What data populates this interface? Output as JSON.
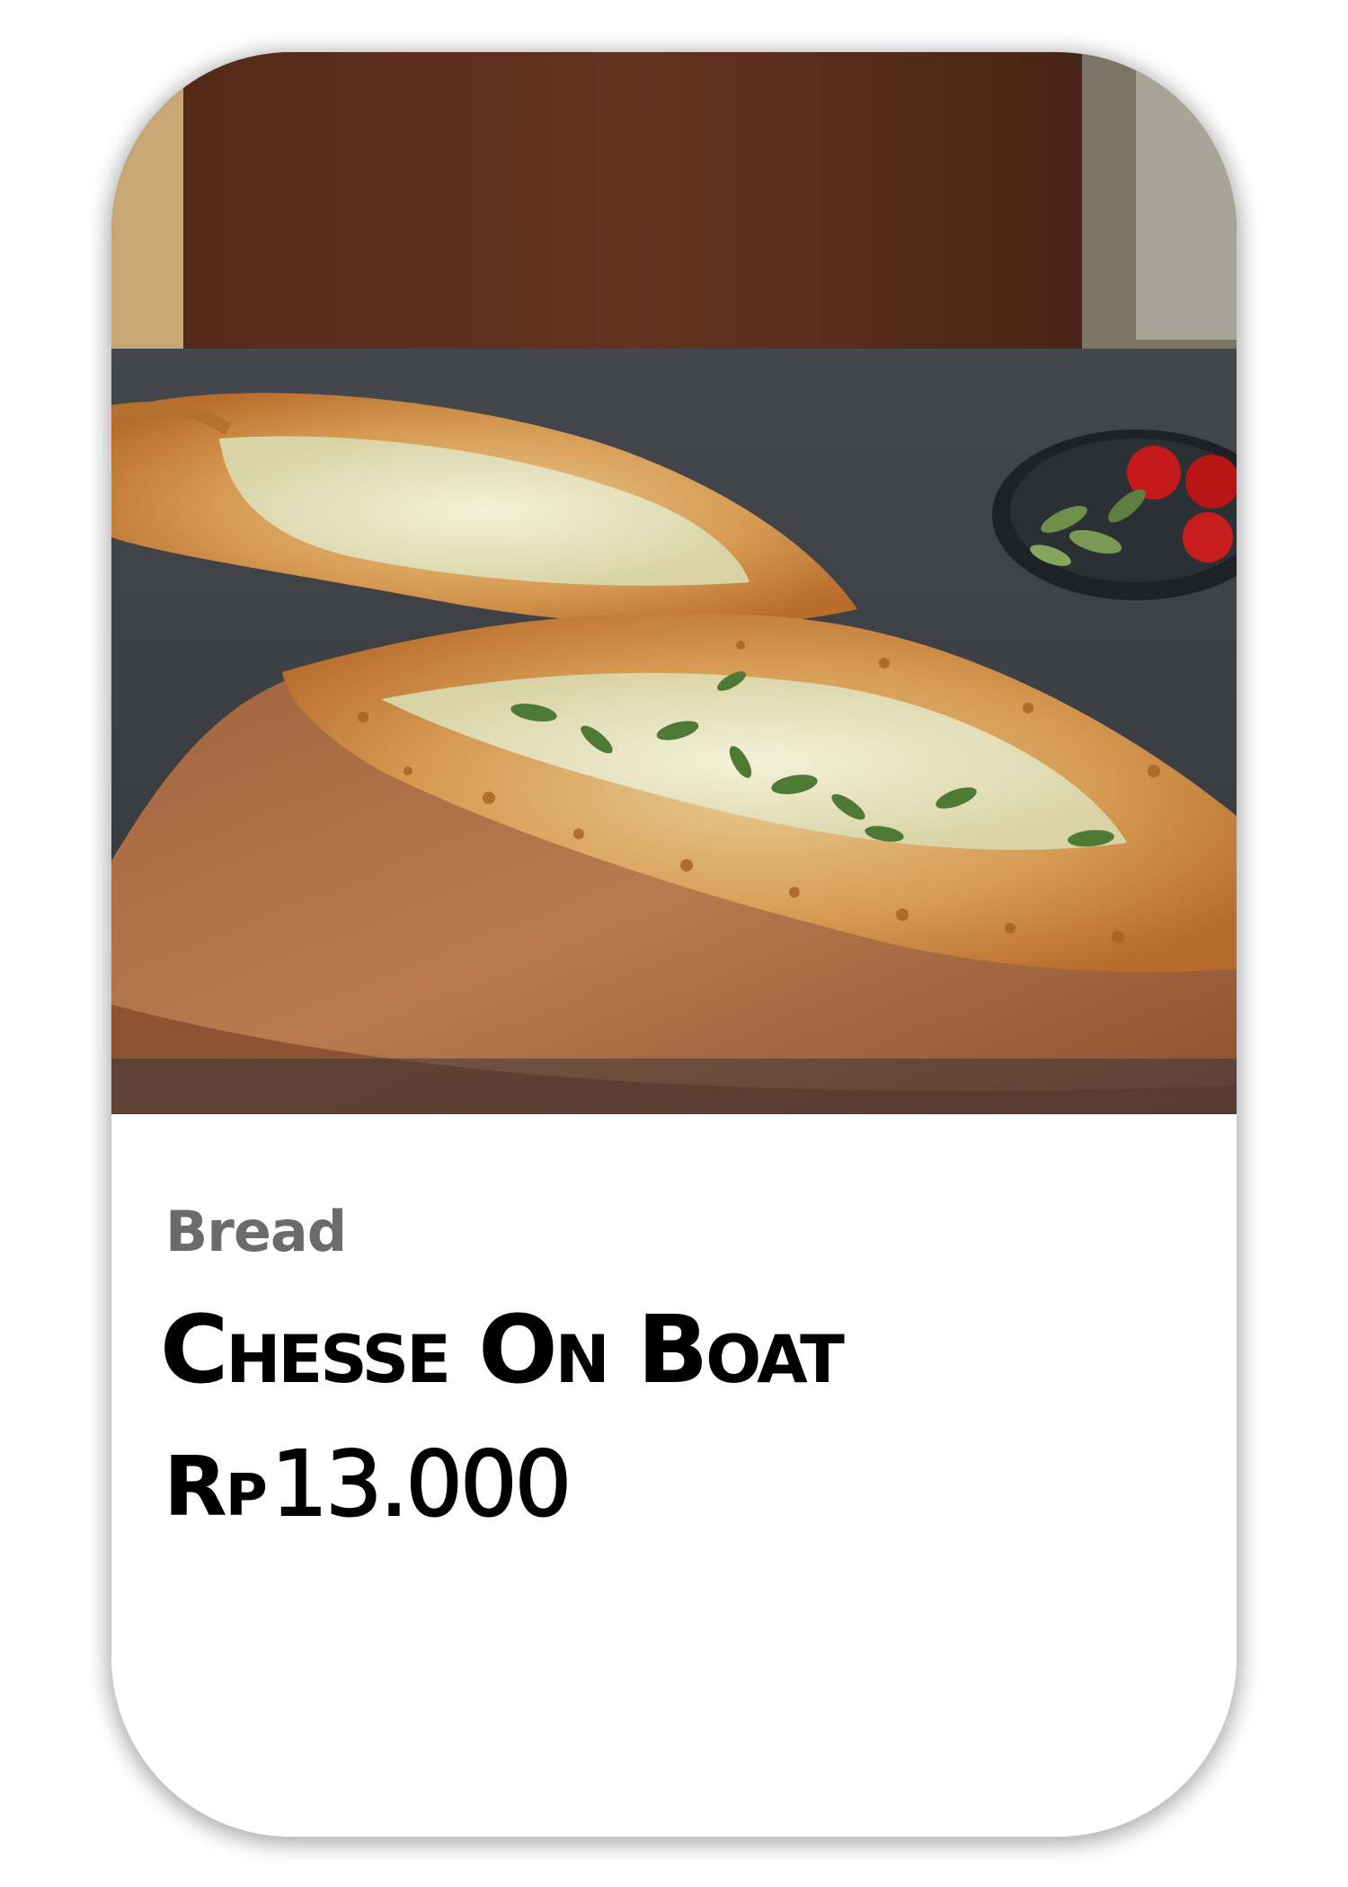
{
  "product": {
    "category": "Bread",
    "name": "Chesse On Boat",
    "price_currency": "Rp",
    "price_amount": "13.000"
  }
}
